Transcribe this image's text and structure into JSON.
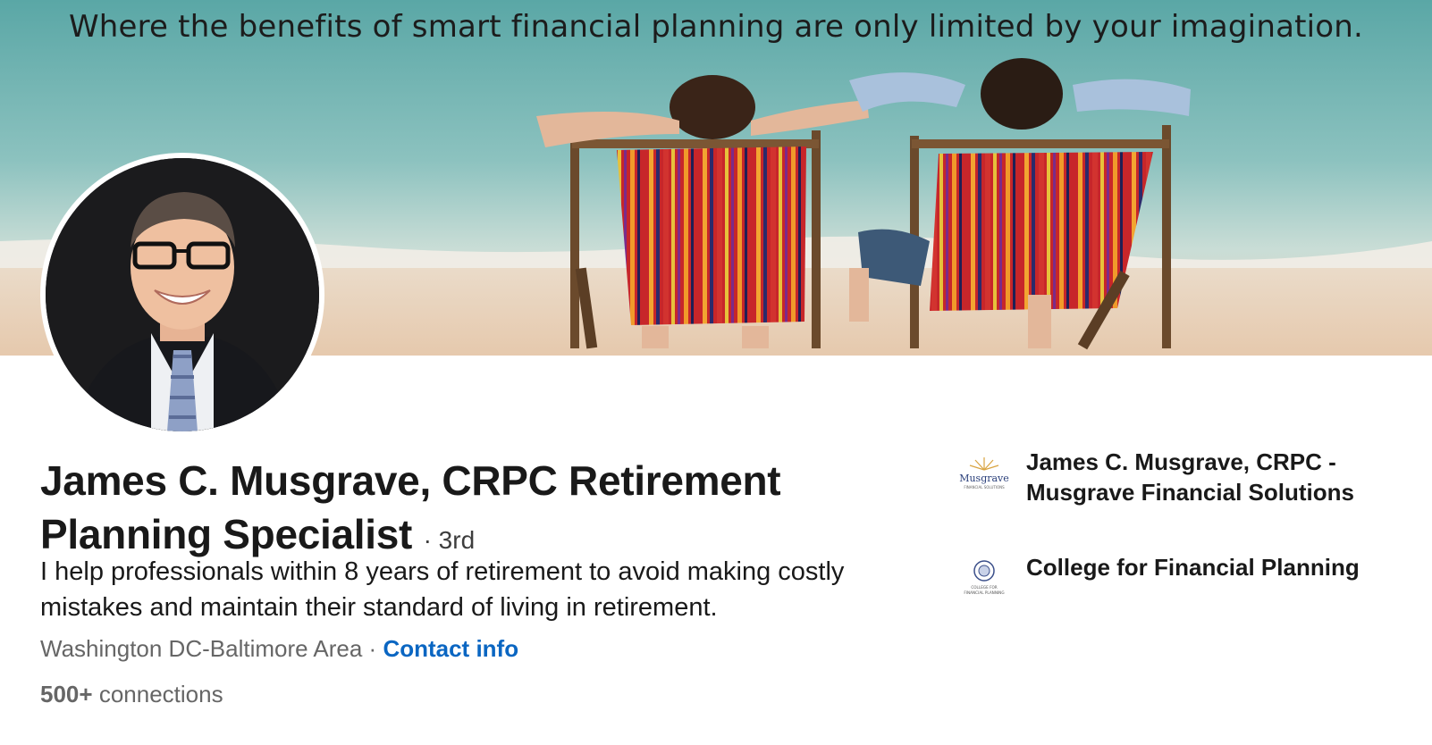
{
  "banner": {
    "tagline": "Where the benefits of smart financial planning are only limited by your imagination."
  },
  "profile": {
    "name": "James C. Musgrave, CRPC Retirement Planning Specialist",
    "degree": "· 3rd",
    "headline": "I help professionals within 8 years of retirement to avoid making costly mistakes and maintain their standard of living in retirement.",
    "location": "Washington DC-Baltimore Area",
    "separator": "·",
    "contact_label": "Contact info",
    "connections_count": "500+",
    "connections_label": "connections"
  },
  "organizations": [
    {
      "name": "James C. Musgrave, CRPC - Musgrave Financial Solutions",
      "logo_text": "Musgrave",
      "logo_subtext": "FINANCIAL SOLUTIONS",
      "logo_icon": "sunburst-icon"
    },
    {
      "name": "College for Financial Planning",
      "logo_text": "COLLEGE FOR FINANCIAL PLANNING",
      "logo_icon": "seal-icon"
    }
  ],
  "colors": {
    "link": "#0a66c2",
    "text_primary": "#191919",
    "text_secondary": "#666666"
  }
}
